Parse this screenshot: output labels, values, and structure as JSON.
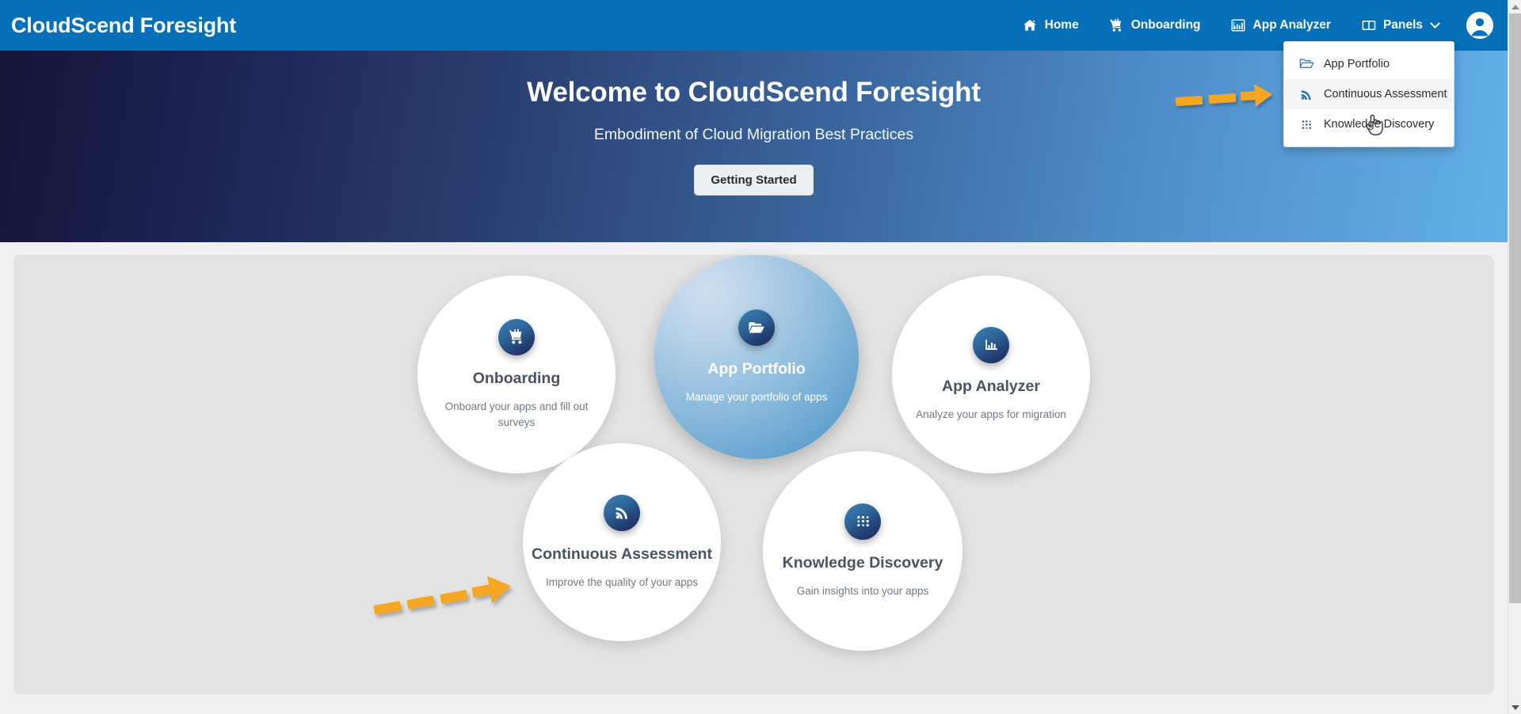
{
  "app": {
    "brand": "CloudScend Foresight",
    "accent_blue": "#0570b8",
    "annotation_orange": "#f5a623"
  },
  "navbar": {
    "items": [
      {
        "label": "Home",
        "icon": "home-icon"
      },
      {
        "label": "Onboarding",
        "icon": "cart-icon"
      },
      {
        "label": "App Analyzer",
        "icon": "bar-chart-icon"
      },
      {
        "label": "Panels",
        "icon": "panels-icon",
        "has_caret": true
      }
    ],
    "avatar_icon": "user-avatar-icon"
  },
  "dropdown": {
    "items": [
      {
        "label": "App Portfolio",
        "icon": "folder-open-icon",
        "hovered": false
      },
      {
        "label": "Continuous Assessment",
        "icon": "rss-icon",
        "hovered": true
      },
      {
        "label": "Knowledge Discovery",
        "icon": "dots-grid-icon",
        "hovered": false
      }
    ]
  },
  "hero": {
    "title": "Welcome to CloudScend Foresight",
    "subtitle": "Embodiment of Cloud Migration Best Practices",
    "button_label": "Getting Started",
    "gradient_from": "#14163a",
    "gradient_to": "#63b0e8"
  },
  "tiles": [
    {
      "id": "onboarding",
      "title": "Onboarding",
      "description": "Onboard your apps and fill out surveys",
      "icon": "cart-icon",
      "active": false
    },
    {
      "id": "portfolio",
      "title": "App Portfolio",
      "description": "Manage your portfolio of apps",
      "icon": "folder-open-icon",
      "active": true
    },
    {
      "id": "analyzer",
      "title": "App Analyzer",
      "description": "Analyze your apps for migration",
      "icon": "bar-chart-icon",
      "active": false
    },
    {
      "id": "continuous",
      "title": "Continuous Assessment",
      "description": "Improve the quality of your apps",
      "icon": "rss-icon",
      "active": false
    },
    {
      "id": "knowledge",
      "title": "Knowledge Discovery",
      "description": "Gain insights into your apps",
      "icon": "dots-grid-icon",
      "active": false
    }
  ],
  "annotations": [
    {
      "id": "arrow-top",
      "type": "dashed-arrow-right",
      "points_to": "Continuous Assessment"
    },
    {
      "id": "arrow-bottom",
      "type": "dashed-arrow-right",
      "points_to": "Continuous Assessment"
    }
  ],
  "scrollbar": {
    "up_arrow": "scroll-up-icon",
    "down_arrow": "scroll-down-icon"
  }
}
